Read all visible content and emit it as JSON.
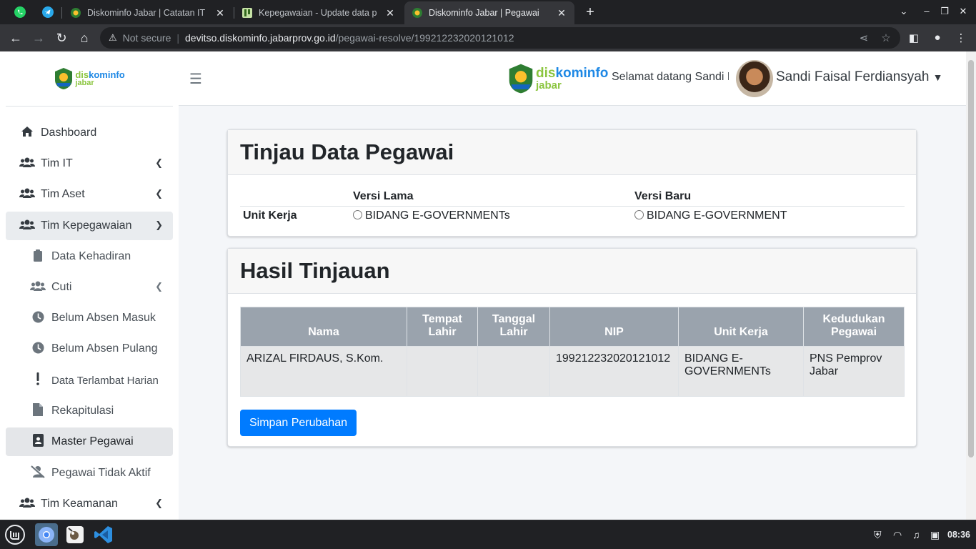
{
  "browser": {
    "tabs": [
      {
        "title": "Diskominfo Jabar | Catatan IT",
        "active": false
      },
      {
        "title": "Kepegawaian - Update data p",
        "active": false
      },
      {
        "title": "Diskominfo Jabar | Pegawai",
        "active": true
      }
    ],
    "close_glyph": "✕",
    "new_tab_glyph": "+",
    "address": {
      "security_label": "Not secure",
      "host": "devitso.diskominfo.jabarprov.go.id",
      "path": "/pegawai-resolve/199212232020121012"
    }
  },
  "brand": {
    "dis": "dis",
    "kominfo": "kominfo",
    "jabar": "jabar"
  },
  "header": {
    "welcome": "Selamat datang Sandi Faisal Ferdiansyah",
    "user_name": "Sandi Faisal Ferdiansyah"
  },
  "sidebar": {
    "items": [
      {
        "label": "Dashboard",
        "icon": "home-icon"
      },
      {
        "label": "Tim IT",
        "icon": "users-icon"
      },
      {
        "label": "Tim Aset",
        "icon": "users-icon"
      },
      {
        "label": "Tim Kepegawaian",
        "icon": "users-icon"
      },
      {
        "label": "Data Kehadiran",
        "icon": "clipboard-icon"
      },
      {
        "label": "Cuti",
        "icon": "users-icon"
      },
      {
        "label": "Belum Absen Masuk",
        "icon": "clock-icon"
      },
      {
        "label": "Belum Absen Pulang",
        "icon": "clock-icon"
      },
      {
        "label": "Data Terlambat Harian",
        "icon": "exclamation-icon"
      },
      {
        "label": "Rekapitulasi",
        "icon": "file-icon"
      },
      {
        "label": "Master Pegawai",
        "icon": "address-card-icon"
      },
      {
        "label": "Pegawai Tidak Aktif",
        "icon": "user-slash-icon"
      },
      {
        "label": "Tim Keamanan",
        "icon": "users-icon"
      }
    ]
  },
  "review": {
    "title": "Tinjau Data Pegawai",
    "col_old": "Versi Lama",
    "col_new": "Versi Baru",
    "row_label": "Unit Kerja",
    "old_value": "BIDANG E-GOVERNMENTs",
    "new_value": "BIDANG E-GOVERNMENT"
  },
  "result": {
    "title": "Hasil Tinjauan",
    "headers": [
      "Nama",
      "Tempat Lahir",
      "Tanggal Lahir",
      "NIP",
      "Unit Kerja",
      "Kedudukan Pegawai"
    ],
    "row": [
      "ARIZAL FIRDAUS, S.Kom.",
      "",
      "",
      "199212232020121012",
      "BIDANG E-GOVERNMENTs",
      "PNS Pemprov Jabar"
    ],
    "save_button": "Simpan Perubahan"
  },
  "taskbar": {
    "clock": "08:36"
  },
  "colors": {
    "primary": "#007bff",
    "table_header": "#9aa3ad",
    "brand_green": "#8bc53f",
    "brand_blue": "#1e88e5"
  }
}
